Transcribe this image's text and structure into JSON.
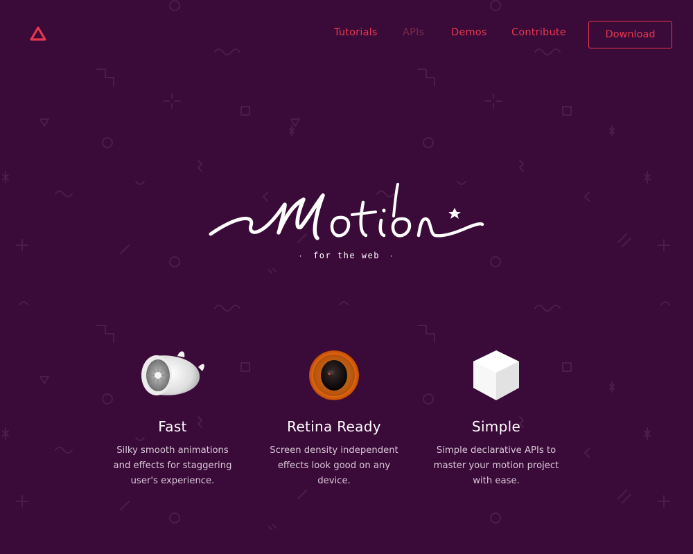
{
  "nav": {
    "logo_icon": "triangle-logo-icon",
    "links": [
      {
        "label": "Tutorials",
        "active": false
      },
      {
        "label": "APIs",
        "active": true
      },
      {
        "label": "Demos",
        "active": false
      },
      {
        "label": "Contribute",
        "active": false
      }
    ],
    "download_label": "Download"
  },
  "hero": {
    "brand_wordmark": "Motion",
    "tagline": "for the web"
  },
  "features": [
    {
      "icon": "jet-engine-icon",
      "title": "Fast",
      "description": "Silky smooth animations and effects for staggering user's experience."
    },
    {
      "icon": "eye-lens-icon",
      "title": "Retina Ready",
      "description": "Screen density independent effects look good on any device."
    },
    {
      "icon": "cube-icon",
      "title": "Simple",
      "description": "Simple declarative APIs to master your motion project with ease."
    }
  ],
  "colors": {
    "background": "#3a0a38",
    "accent": "#e8384f",
    "active_link": "#7d2a4a",
    "text_primary": "#ffffff",
    "text_secondary": "#d9c9d8"
  }
}
